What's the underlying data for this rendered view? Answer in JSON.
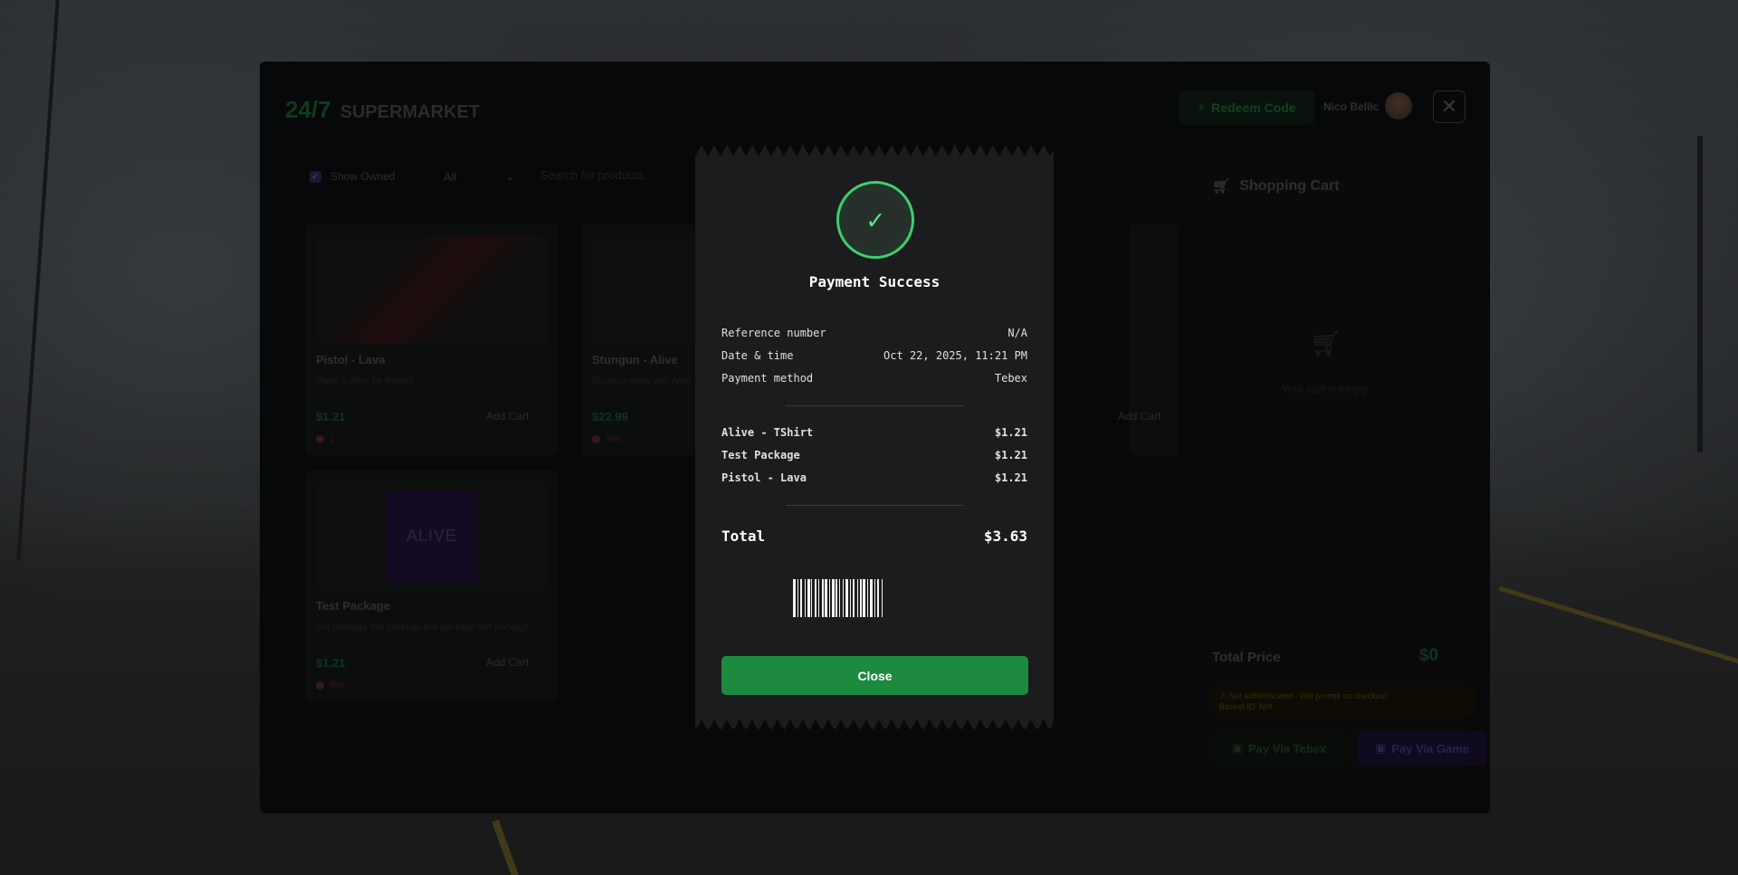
{
  "shop": {
    "logo_number": "24/7",
    "logo_name": "SUPERMARKET",
    "redeem_label": "Redeem Code",
    "user_name": "Nico Bellic",
    "close_symbol": "✕",
    "filters": {
      "show_owned_label": "Show Owned",
      "category_value": "All",
      "search_placeholder": "Search for products..."
    },
    "products": [
      {
        "title": "Pistol - Lava",
        "desc": "Made in Alive by Renerh",
        "price": "$1.21",
        "add_label": "Add Cart",
        "stock": "1"
      },
      {
        "title": "Stungun - Alive",
        "desc": "Stungun made with Alive",
        "price": "$22.99",
        "add_label": "Add Cart",
        "stock": "999"
      },
      {
        "title": "",
        "desc": "",
        "price": "",
        "add_label": "Add Cart",
        "stock": ""
      },
      {
        "title": "Test Package",
        "desc": "test package test package test package test package",
        "price": "$1.21",
        "add_label": "Add Cart",
        "stock": "998",
        "image_text": "ALIVE"
      }
    ]
  },
  "cart": {
    "title": "Shopping Cart",
    "empty_text": "Your cart is empty",
    "total_label": "Total Price",
    "total_value": "$0",
    "auth_warning": "⚠ Not authenticated - Will prompt on checkout",
    "basket_line": "Basket ID: N/A",
    "pay_tebex_label": "Pay Via Tebex",
    "pay_game_label": "Pay Via Game"
  },
  "receipt": {
    "title": "Payment Success",
    "check_symbol": "✓",
    "details": [
      {
        "label": "Reference number",
        "value": "N/A"
      },
      {
        "label": "Date & time",
        "value": "Oct 22, 2025, 11:21 PM"
      },
      {
        "label": "Payment method",
        "value": "Tebex"
      }
    ],
    "items": [
      {
        "name": "Alive - TShirt",
        "price": "$1.21"
      },
      {
        "name": "Test Package",
        "price": "$1.21"
      },
      {
        "name": "Pistol - Lava",
        "price": "$1.21"
      }
    ],
    "total_label": "Total",
    "total_value": "$3.63",
    "close_label": "Close"
  },
  "colors": {
    "accent_green": "#1d8a3f",
    "success_ring": "#3ecf6e",
    "receipt_bg": "#1b1c1e"
  }
}
